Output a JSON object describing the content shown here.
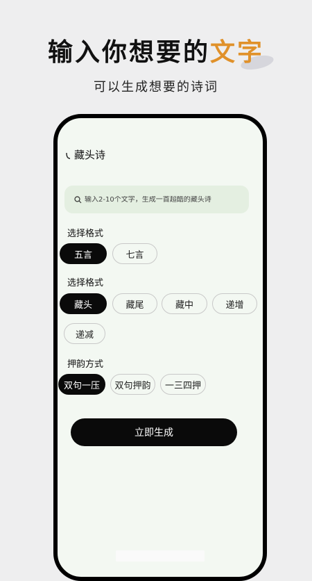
{
  "header": {
    "headline_main": "输入你想要的",
    "headline_highlight": "文字",
    "subtitle": "可以生成想要的诗词"
  },
  "app": {
    "nav_title": "藏头诗",
    "search": {
      "placeholder": "输入2-10个文字，生成一首超酷的藏头诗"
    },
    "sections": [
      {
        "label": "选择格式",
        "options": [
          "五言",
          "七言"
        ],
        "selected": "五言"
      },
      {
        "label": "选择格式",
        "options": [
          "藏头",
          "藏尾",
          "藏中",
          "递增",
          "递减"
        ],
        "selected": "藏头"
      },
      {
        "label": "押韵方式",
        "options": [
          "双句一压",
          "双句押韵",
          "一三四押"
        ],
        "selected": "双句一压"
      }
    ],
    "generate_label": "立即生成"
  },
  "colors": {
    "accent": "#e0912a",
    "active_chip": "#0a0a0a",
    "search_bg": "#e4efe1",
    "screen_bg": "#f3f8f2"
  }
}
